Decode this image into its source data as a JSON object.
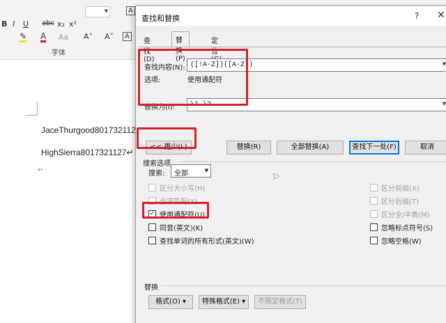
{
  "ribbon": {
    "bold": "B",
    "italic": "I",
    "underline": "U",
    "strike": "abc",
    "subscript": "x₂",
    "superscript": "x²",
    "clear_format": "A",
    "grow_font": "A˄",
    "shrink_font": "A˅",
    "change_case": "Aa",
    "group_label": "字体"
  },
  "document": {
    "lines": [
      "JaceThurgood801732112",
      "HighSierra8017321127↵"
    ]
  },
  "dialog": {
    "title": "查找和替换",
    "help": "?",
    "close": "✕",
    "tabs": [
      "查找(D)",
      "替换(P)",
      "定位(G)"
    ],
    "find_label": "查找内容(N):",
    "find_value": "([!A-Z])([A-Z])",
    "options_label": "选项:",
    "options_value": "使用通配符",
    "replace_label": "替换为(I):",
    "replace_value": "\\1 \\2",
    "buttons": {
      "less": "<< 更少(L)",
      "replace": "替换(R)",
      "replace_all": "全部替换(A)",
      "find_next": "查找下一处(F)",
      "cancel": "取消"
    },
    "search_options_title": "搜索选项",
    "search_label": "搜索:",
    "search_value": "全部",
    "checkboxes_left": [
      {
        "label": "区分大小写(H)",
        "checked": false,
        "enabled": false
      },
      {
        "label": "全字匹配(Y)",
        "checked": false,
        "enabled": false
      },
      {
        "label": "使用通配符(U)",
        "checked": true,
        "enabled": true
      },
      {
        "label": "同音(英文)(K)",
        "checked": false,
        "enabled": true
      },
      {
        "label": "查找单词的所有形式(英文)(W)",
        "checked": false,
        "enabled": true
      }
    ],
    "checkboxes_right": [
      {
        "label": "区分前缀(X)",
        "checked": false,
        "enabled": false
      },
      {
        "label": "区分后缀(T)",
        "checked": false,
        "enabled": false
      },
      {
        "label": "区分全/半角(M)",
        "checked": false,
        "enabled": false
      },
      {
        "label": "忽略标点符号(S)",
        "checked": false,
        "enabled": true
      },
      {
        "label": "忽略空格(W)",
        "checked": false,
        "enabled": true
      }
    ],
    "replace_section_title": "替换",
    "format_button": "格式(O) ▾",
    "special_button": "特殊格式(E) ▾",
    "no_format_button": "不限定格式(T)"
  },
  "colors": {
    "highlight": "#d4202a",
    "accent": "#0078d7"
  }
}
